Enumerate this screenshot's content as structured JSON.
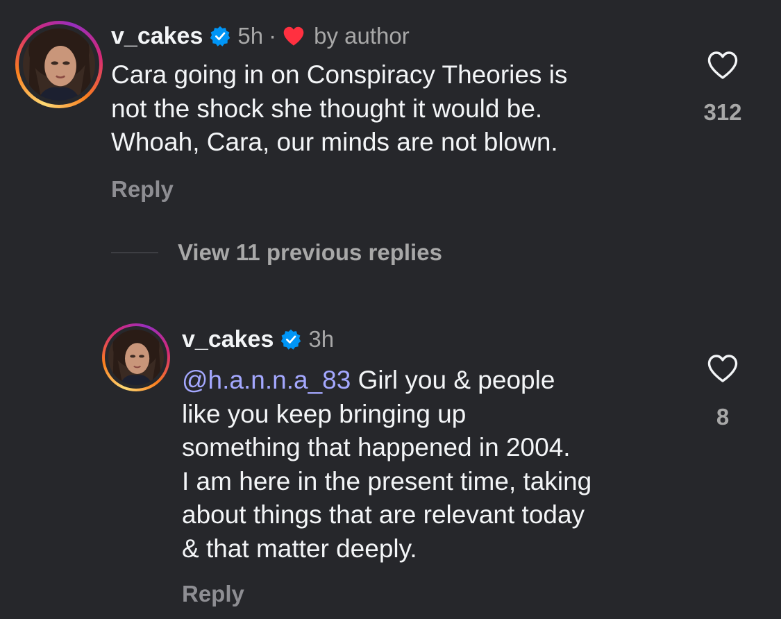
{
  "comments": [
    {
      "username": "v_cakes",
      "time": "5h",
      "separator": "·",
      "liked_by_author": "by author",
      "body": "Cara going in on Conspiracy Theories is\nnot the shock she thought it would be.\nWhoah, Cara, our minds are not blown.",
      "reply_label": "Reply",
      "like_count": "312"
    }
  ],
  "view_replies": {
    "label": "View 11 previous replies"
  },
  "replies": [
    {
      "username": "v_cakes",
      "time": "3h",
      "mention": "@h.a.n.n.a_83",
      "body": " Girl you & people\nlike you keep bringing up\nsomething that happened in 2004.\nI am here in the present time, taking\nabout things that are relevant today\n& that matter deeply.",
      "reply_label": "Reply",
      "like_count": "8"
    }
  ],
  "colors": {
    "background": "#26272b",
    "text": "#f3f5f7",
    "secondary": "#a8a8a8",
    "mention": "#a4a8ff",
    "verified": "#0095f6",
    "heart": "#ff3040"
  },
  "icons": [
    "verified-badge-icon",
    "heart-filled-icon",
    "heart-outline-icon"
  ]
}
